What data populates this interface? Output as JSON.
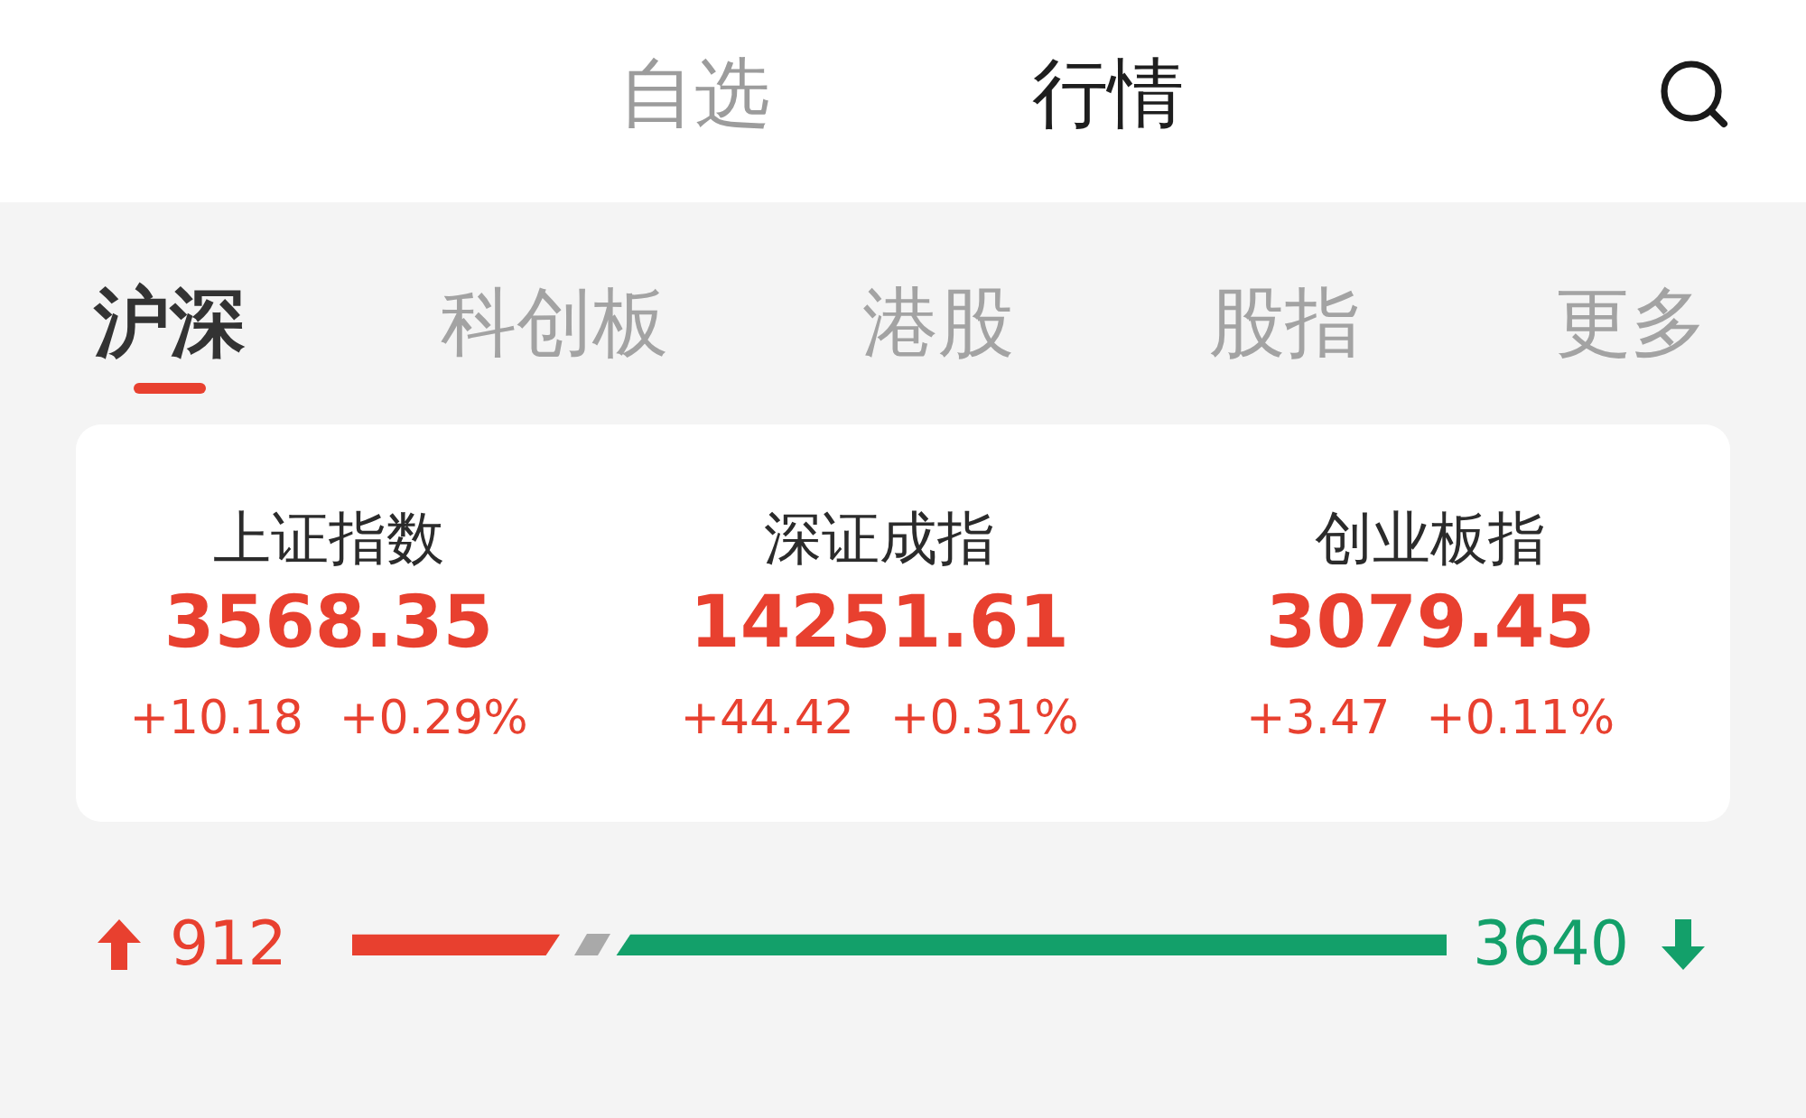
{
  "header": {
    "tabs": [
      {
        "label": "自选",
        "selected": false
      },
      {
        "label": "行情",
        "selected": true
      }
    ]
  },
  "market_tabs": [
    {
      "label": "沪深",
      "selected": true
    },
    {
      "label": "科创板",
      "selected": false
    },
    {
      "label": "港股",
      "selected": false
    },
    {
      "label": "股指",
      "selected": false
    },
    {
      "label": "更多",
      "selected": false
    }
  ],
  "indices": [
    {
      "name": "上证指数",
      "value": "3568.35",
      "change": "+10.18",
      "change_percent": "+0.29%"
    },
    {
      "name": "深证成指",
      "value": "14251.61",
      "change": "+44.42",
      "change_percent": "+0.31%"
    },
    {
      "name": "创业板指",
      "value": "3079.45",
      "change": "+3.47",
      "change_percent": "+0.11%"
    }
  ],
  "breadth": {
    "up_count": "912",
    "down_count": "3640",
    "level": 0.2
  }
}
